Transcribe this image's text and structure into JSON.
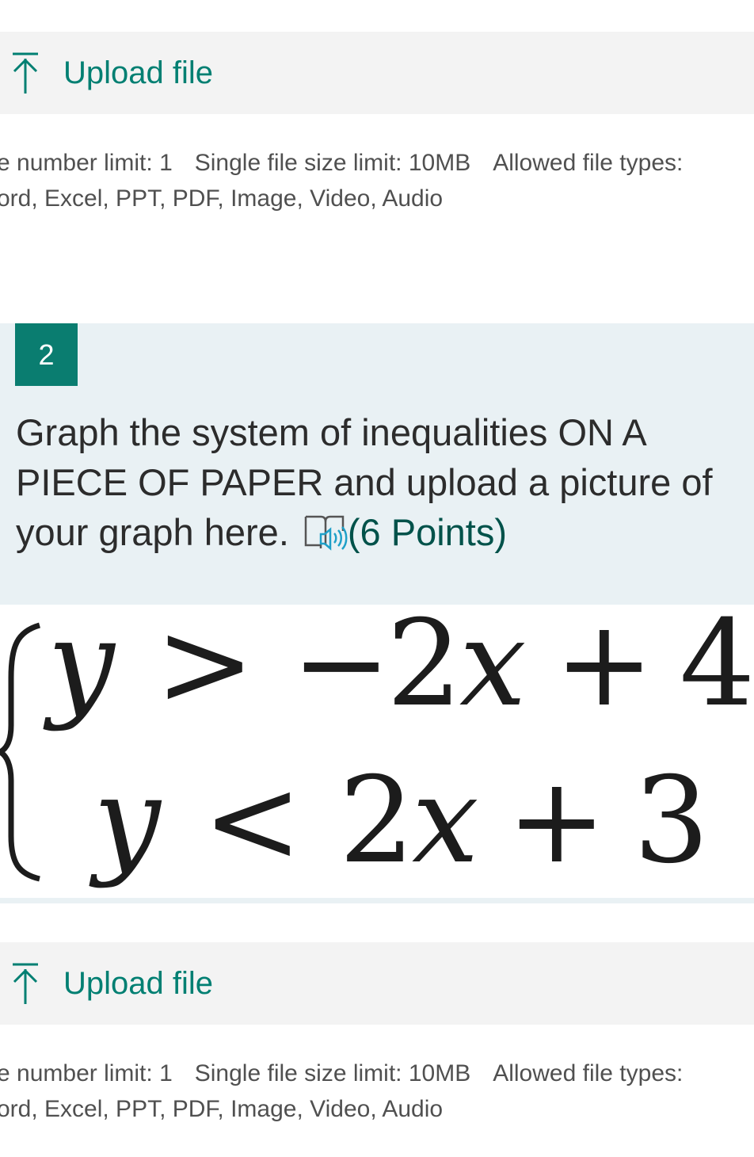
{
  "upload_sections": [
    {
      "button_label": "Upload file",
      "icon": "upload-arrow-icon",
      "limits_line1_part1": "e number limit: 1",
      "limits_line1_part2": "Single file size limit: 10MB",
      "limits_line1_part3": "Allowed file types:",
      "limits_line2": "ord, Excel, PPT, PDF, Image, Video, Audio"
    },
    {
      "button_label": "Upload file",
      "icon": "upload-arrow-icon",
      "limits_line1_part1": "e number limit: 1",
      "limits_line1_part2": "Single file size limit: 10MB",
      "limits_line1_part3": "Allowed file types:",
      "limits_line2": "ord, Excel, PPT, PDF, Image, Video, Audio"
    }
  ],
  "question": {
    "number": "2",
    "text": "Graph the system of inequalities ON A PIECE OF PAPER and upload a picture of your graph here.",
    "reader_icon": "immersive-reader-icon",
    "points": "(6 Points)"
  },
  "equation": {
    "line1": {
      "var": "y",
      "op": ">",
      "rhs_neg": "−",
      "coef": "2",
      "x": "x",
      "plus": "+",
      "const": "4"
    },
    "line2": {
      "var": "y",
      "op": "<",
      "coef": "2",
      "x": "x",
      "plus": "+",
      "const": "3"
    }
  },
  "colors": {
    "accent": "#007f72",
    "badge": "#0a7d70",
    "question_bg": "#e9f1f4",
    "upload_bg": "#f3f3f3"
  }
}
